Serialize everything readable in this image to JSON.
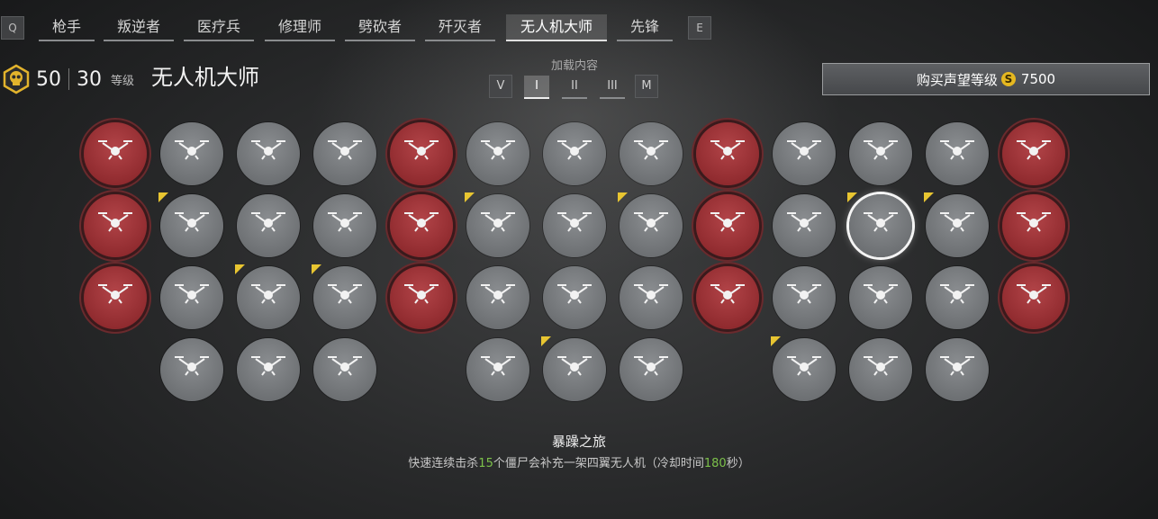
{
  "tabs": {
    "prev_key": "Q",
    "next_key": "E",
    "items": [
      "枪手",
      "叛逆者",
      "医疗兵",
      "修理师",
      "劈砍者",
      "歼灭者",
      "无人机大师",
      "先锋"
    ],
    "active_index": 6
  },
  "level": {
    "current": "50",
    "prestige": "30",
    "label": "等级"
  },
  "class_title": "无人机大师",
  "loadout": {
    "label": "加载内容",
    "prev_key": "V",
    "next_key": "M",
    "slots": [
      "I",
      "II",
      "III"
    ],
    "active_index": 0
  },
  "buy": {
    "label": "购买声望等级",
    "currency_icon": "S",
    "price": "7500"
  },
  "perks": {
    "columns": 13,
    "rows": [
      [
        "red",
        "grey",
        "grey",
        "grey",
        "red",
        "grey",
        "grey",
        "grey",
        "red",
        "grey",
        "grey",
        "grey",
        "red"
      ],
      [
        "red",
        "grey-new",
        "grey",
        "grey",
        "red",
        "grey-new",
        "grey",
        "grey-new",
        "red",
        "grey",
        "selected-new",
        "grey-new",
        "red"
      ],
      [
        "red",
        "grey",
        "grey-new",
        "grey-new",
        "red",
        "grey",
        "grey",
        "grey",
        "red",
        "grey",
        "grey",
        "grey",
        "red"
      ],
      [
        "",
        "grey",
        "grey",
        "grey",
        "",
        "grey",
        "grey-new",
        "grey",
        "",
        "grey-new",
        "grey",
        "grey",
        ""
      ]
    ],
    "colors": {
      "red": "#8f2a2e",
      "grey": "#6c6f72",
      "new_flag": "#e8c531"
    }
  },
  "description": {
    "title": "暴躁之旅",
    "text_before": "快速连续击杀",
    "kills": "15",
    "text_middle": "个僵尸会补充一架四翼无人机（冷却时间",
    "cooldown": "180",
    "text_after": "秒）"
  }
}
